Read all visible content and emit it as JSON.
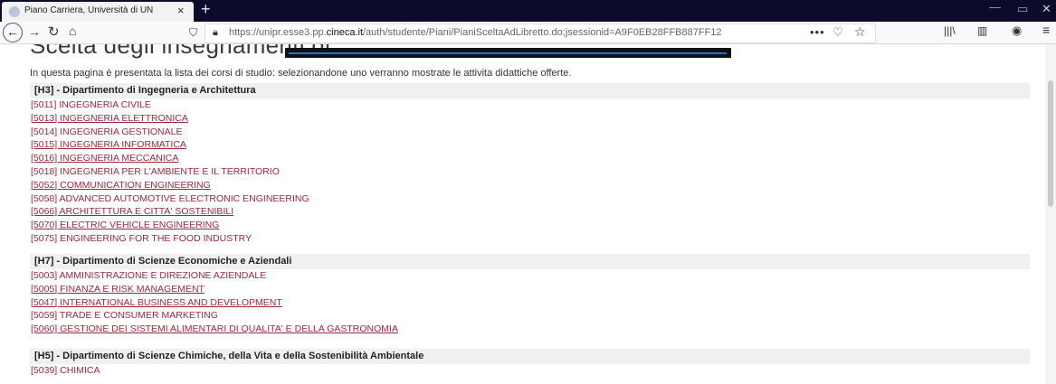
{
  "browser": {
    "tab_title": "Piano Carriera, Università di UN",
    "tab_close": "×",
    "new_tab": "+",
    "url_prefix": "https://unipr.esse3.pp.",
    "url_domain": "cineca.it",
    "url_path": "/auth/studente/Piani/PianiSceltaAdLibretto.do;jsessionid=A9F0EB28FFB887FF12",
    "icons": [
      "back-icon",
      "forward-icon",
      "reload-icon",
      "home-icon",
      "shield-icon",
      "lock-icon",
      "more-icon",
      "pocket-icon",
      "star-icon",
      "library-icon",
      "sidebar-icon",
      "account-icon",
      "menu-icon"
    ]
  },
  "page": {
    "heading": "Scelta degli insegnamenti di:",
    "intro": "In questa pagina è presentata la lista dei corsi di studio: selezionandone uno verranno mostrate le attivita didattiche offerte."
  },
  "departments": [
    {
      "label": "[H3] - Dipartimento di Ingegneria e Architettura",
      "courses": [
        {
          "text": "[5011] INGEGNERIA CIVILE",
          "underline": false
        },
        {
          "text": "[5013] INGEGNERIA ELETTRONICA",
          "underline": true
        },
        {
          "text": "[5014] INGEGNERIA GESTIONALE",
          "underline": false
        },
        {
          "text": "[5015] INGEGNERIA INFORMATICA",
          "underline": true
        },
        {
          "text": "[5016] INGEGNERIA MECCANICA",
          "underline": true
        },
        {
          "text": "[5018] INGEGNERIA PER L'AMBIENTE E IL TERRITORIO",
          "underline": false
        },
        {
          "text": "[5052] COMMUNICATION ENGINEERING",
          "underline": true
        },
        {
          "text": "[5058] ADVANCED AUTOMOTIVE ELECTRONIC ENGINEERING",
          "underline": false
        },
        {
          "text": "[5066] ARCHITETTURA E CITTA' SOSTENIBILI",
          "underline": true
        },
        {
          "text": "[5070] ELECTRIC VEHICLE ENGINEERING",
          "underline": true
        },
        {
          "text": "[5075] ENGINEERING FOR THE FOOD INDUSTRY",
          "underline": false
        }
      ]
    },
    {
      "label": "[H7] - Dipartimento di Scienze Economiche e Aziendali",
      "courses": [
        {
          "text": "[5003] AMMINISTRAZIONE E DIREZIONE AZIENDALE",
          "underline": false
        },
        {
          "text": "[5005] FINANZA E RISK MANAGEMENT",
          "underline": true
        },
        {
          "text": "[5047] INTERNATIONAL BUSINESS AND DEVELOPMENT",
          "underline": true
        },
        {
          "text": "[5059] TRADE E CONSUMER MARKETING",
          "underline": false
        },
        {
          "text": "[5060] GESTIONE DEI SISTEMI ALIMENTARI DI QUALITA' E DELLA GASTRONOMIA",
          "underline": true
        }
      ]
    },
    {
      "label": "[H5] - Dipartimento di Scienze Chimiche, della Vita e della Sostenibilità Ambientale",
      "courses": [
        {
          "text": "[5039] CHIMICA",
          "underline": false
        }
      ]
    }
  ],
  "colors": {
    "link": "#a3283a",
    "tabstrip": "#0c0c2a",
    "dept_band": "#f0f0f0"
  }
}
